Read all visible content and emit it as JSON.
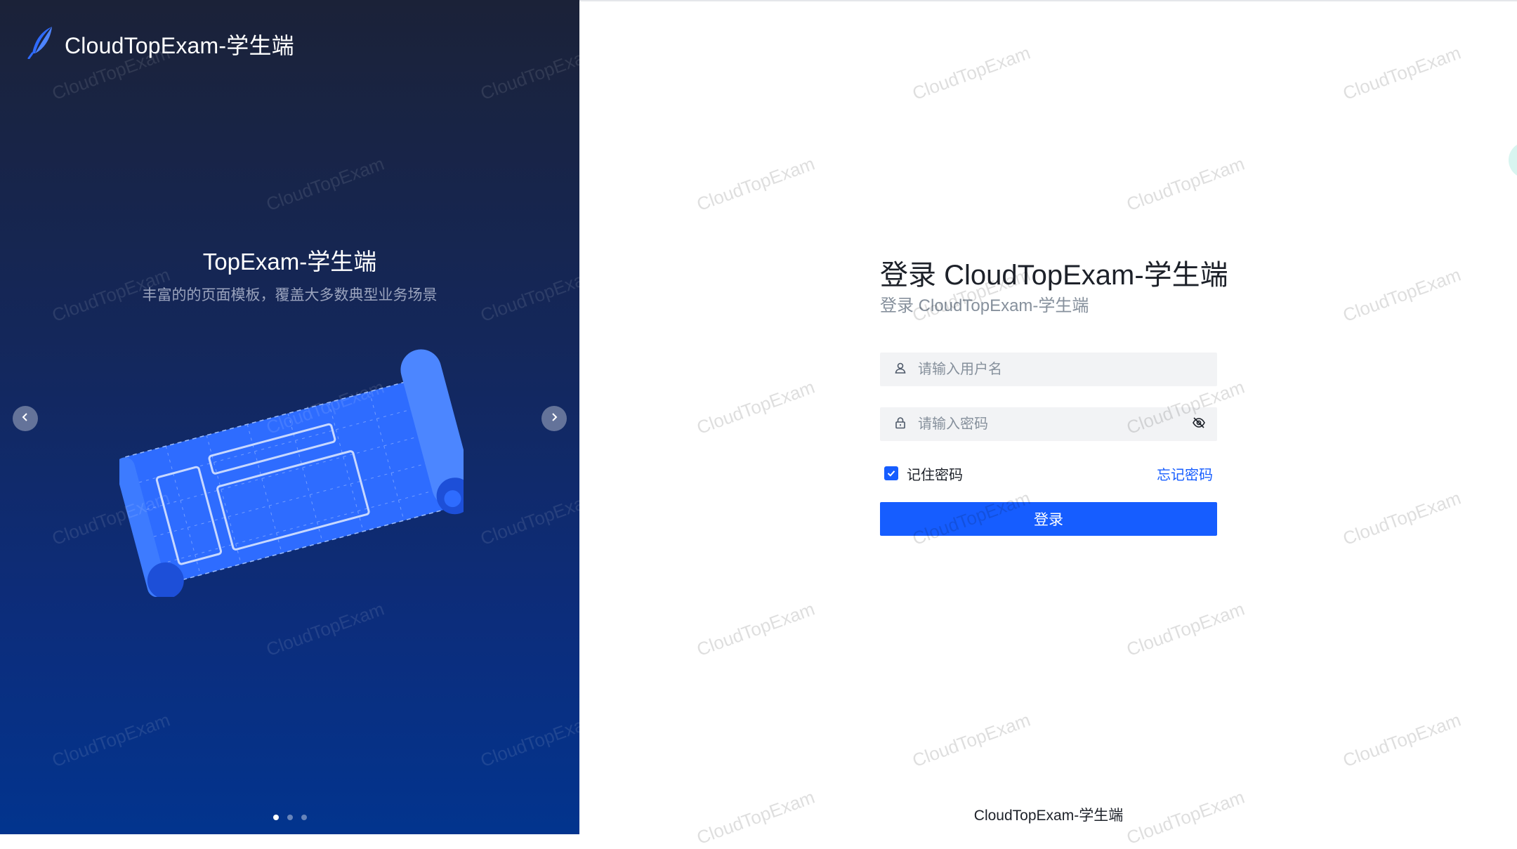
{
  "brand": {
    "name": "CloudTopExam-学生端"
  },
  "carousel": {
    "title": "TopExam-学生端",
    "subtitle": "丰富的的页面模板，覆盖大多数典型业务场景"
  },
  "login": {
    "title": "登录 CloudTopExam-学生端",
    "subtitle": "登录 CloudTopExam-学生端",
    "username_placeholder": "请输入用户名",
    "password_placeholder": "请输入密码",
    "remember_label": "记住密码",
    "remember_checked": true,
    "forgot_label": "忘记密码",
    "submit_label": "登录"
  },
  "footer": {
    "text": "CloudTopExam-学生端"
  },
  "watermark": {
    "text": "CloudTopExam"
  },
  "colors": {
    "primary": "#165dff",
    "panel_dark": "#1b2238",
    "panel_blue": "#02348e",
    "input_bg": "#f2f3f5"
  },
  "icons": {
    "logo": "feather-icon",
    "prev": "chevron-left-icon",
    "next": "chevron-right-icon",
    "user": "user-icon",
    "lock": "lock-icon",
    "eye": "eye-slash-icon",
    "check": "check-icon"
  }
}
